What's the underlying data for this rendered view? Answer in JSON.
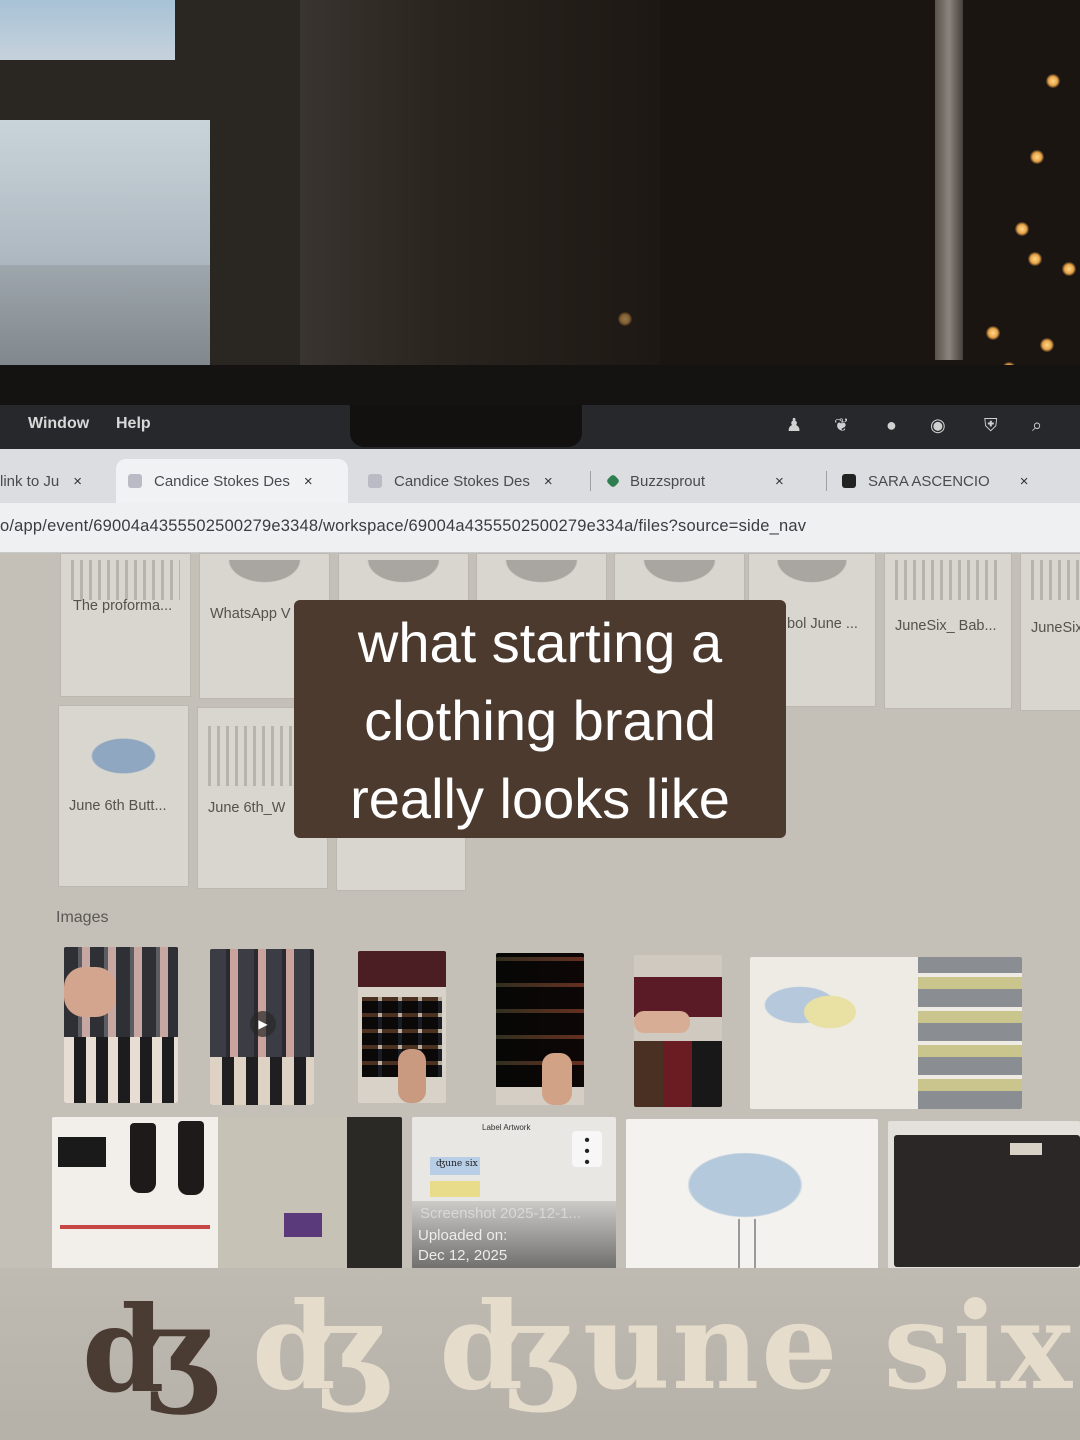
{
  "menubar": {
    "items": [
      "Window",
      "Help"
    ]
  },
  "tabs": [
    {
      "title": "link to Ju",
      "close": "×"
    },
    {
      "title": "Candice Stokes Des",
      "close": "×"
    },
    {
      "title": "Candice Stokes Des",
      "close": "×"
    },
    {
      "title": "Buzzsprout",
      "close": "×"
    },
    {
      "title": "SARA ASCENCIO",
      "close": "×"
    }
  ],
  "url": "o/app/event/69004a4355502500279e3348/workspace/69004a4355502500279e334a/files?source=side_nav",
  "files": {
    "row1": [
      "The proforma...",
      "WhatsApp V",
      "",
      "",
      "",
      "bol June ...",
      "JuneSix_ Bab...",
      "JuneSix"
    ],
    "row2": [
      "June 6th Butt...",
      "June 6th_W",
      ""
    ]
  },
  "images_label": "Images",
  "screenshot_overlay": {
    "name": "Screenshot 2025-12-1...",
    "uploaded_label": "Uploaded on:",
    "date": "Dec 12, 2025"
  },
  "tiny_texts": {
    "label_artwork": "Label Artwork",
    "june_six_tag": "ʤune six"
  },
  "caption": {
    "line1": "what starting a",
    "line2": "clothing brand",
    "line3": "really looks like"
  },
  "logo": {
    "mark": "ʤ",
    "wordmark": "ʤ ʤune six"
  },
  "colors": {
    "caption_bg": "#4d3a2e",
    "logo_mark": "#4a3b33",
    "logo_wordmark": "#e6dccb",
    "page_bg": "#c4c0b8"
  }
}
